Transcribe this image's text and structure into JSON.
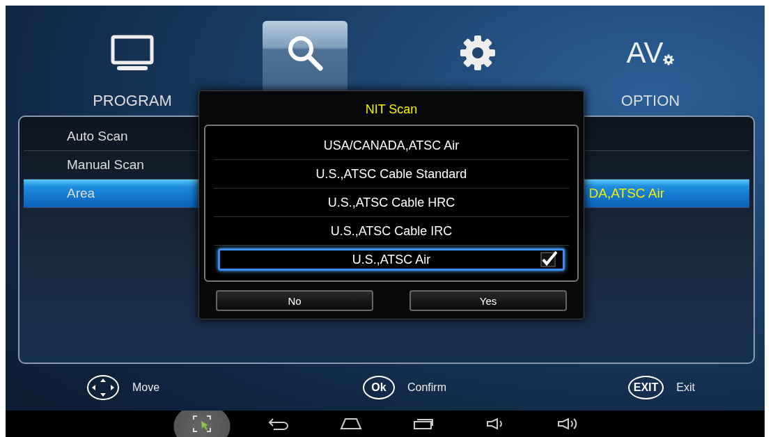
{
  "tabs": [
    {
      "kind": "tv",
      "label": "PROGRAM",
      "selected": false
    },
    {
      "kind": "search",
      "selected": true
    },
    {
      "kind": "gear",
      "selected": false
    },
    {
      "kind": "av",
      "icon_text": "AV",
      "label": "OPTION",
      "selected": false
    }
  ],
  "menu": [
    {
      "label": "Auto Scan",
      "selected": false
    },
    {
      "label": "Manual Scan",
      "selected": false
    },
    {
      "label": "Area",
      "value": "DA,ATSC Air",
      "selected": true
    }
  ],
  "dialog": {
    "title": "NIT Scan",
    "options": [
      {
        "label": "USA/CANADA,ATSC Air",
        "selected": false,
        "checked": false
      },
      {
        "label": "U.S.,ATSC Cable Standard",
        "selected": false,
        "checked": false
      },
      {
        "label": "U.S.,ATSC Cable HRC",
        "selected": false,
        "checked": false
      },
      {
        "label": "U.S.,ATSC Cable IRC",
        "selected": false,
        "checked": false
      },
      {
        "label": "U.S.,ATSC Air",
        "selected": true,
        "checked": true
      }
    ],
    "buttons": [
      "No",
      "Yes"
    ]
  },
  "hints": [
    {
      "kind": "dpad",
      "label": "Move"
    },
    {
      "kind": "key",
      "key": "Ok",
      "label": "Confirm"
    },
    {
      "kind": "key",
      "key": "EXIT",
      "label": "Exit"
    }
  ],
  "nav_bar": [
    {
      "kind": "screenshot",
      "selected": true
    },
    {
      "kind": "back",
      "selected": false
    },
    {
      "kind": "home",
      "selected": false
    },
    {
      "kind": "recents",
      "selected": false
    },
    {
      "kind": "volume-down",
      "selected": false
    },
    {
      "kind": "volume-up",
      "selected": false
    }
  ]
}
